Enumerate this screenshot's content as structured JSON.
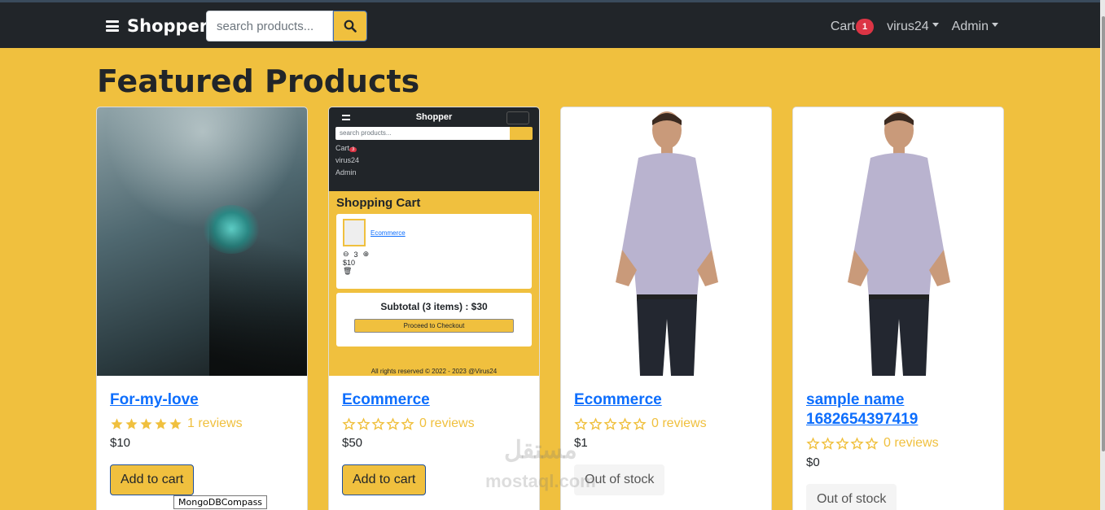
{
  "navbar": {
    "brand": "Shopper",
    "search_placeholder": "search products...",
    "cart_label": "Cart",
    "cart_count": "1",
    "user_label": "virus24",
    "admin_label": "Admin"
  },
  "page": {
    "title": "Featured Products"
  },
  "products": [
    {
      "name": "For-my-love",
      "reviews": "1 reviews",
      "rating": 5,
      "price": "$10",
      "action": "Add to cart",
      "in_stock": true
    },
    {
      "name": "Ecommerce",
      "reviews": "0 reviews",
      "rating": 0,
      "price": "$50",
      "action": "Add to cart",
      "in_stock": true
    },
    {
      "name": "Ecommerce",
      "reviews": "0 reviews",
      "rating": 0,
      "price": "$1",
      "action": "Out of stock",
      "in_stock": false
    },
    {
      "name": "sample name 1682654397419",
      "reviews": "0 reviews",
      "rating": 0,
      "price": "$0",
      "action": "Out of stock",
      "in_stock": false
    }
  ],
  "mini_screenshot": {
    "brand": "Shopper",
    "search_placeholder": "search products...",
    "cart_label": "Cart",
    "cart_count": "3",
    "user_label": "virus24",
    "admin_label": "Admin",
    "heading": "Shopping Cart",
    "item_link": "Ecommerce",
    "qty": "3",
    "item_price": "$10",
    "subtotal": "Subtotal (3 items) : $30",
    "checkout": "Proceed to Checkout",
    "footer": "All rights reserved © 2022 - 2023 @Virus24"
  },
  "tooltip": "MongoDBCompass",
  "watermark": {
    "arabic": "مستقل",
    "latin": "mostaql.com"
  },
  "colors": {
    "accent": "#f0c03e",
    "navbar": "#212529",
    "link": "#0d6efd",
    "badge": "#dc3545"
  }
}
